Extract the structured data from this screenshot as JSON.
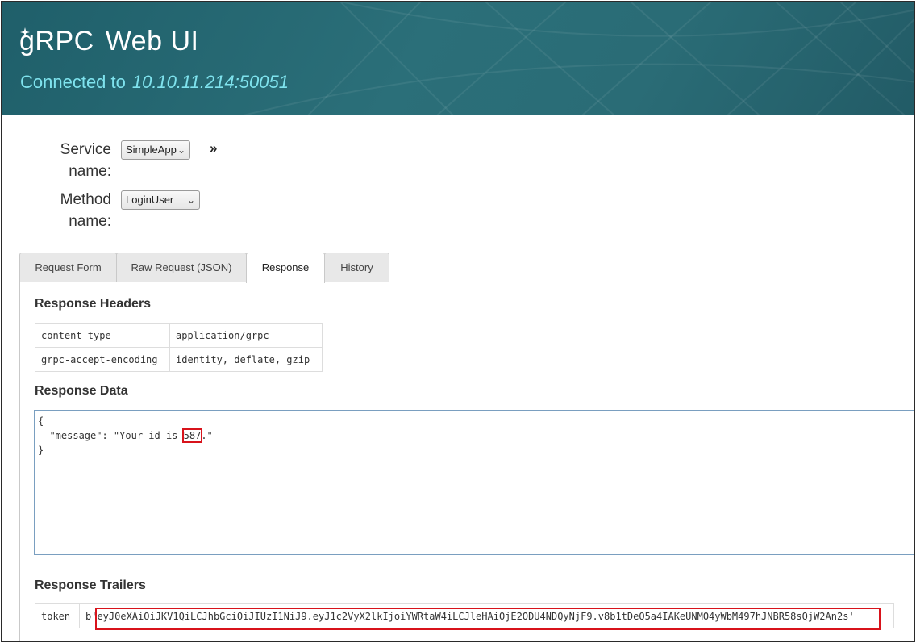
{
  "header": {
    "logo_text": "gRPC",
    "app_title": "Web UI",
    "connected_label": "Connected to",
    "address": "10.10.11.214:50051"
  },
  "selectors": {
    "service_label": "Service name:",
    "service_value": "SimpleApp",
    "method_label": "Method name:",
    "method_value": "LoginUser",
    "expand_glyph": "»"
  },
  "tabs": [
    {
      "label": "Request Form",
      "active": false
    },
    {
      "label": "Raw Request (JSON)",
      "active": false
    },
    {
      "label": "Response",
      "active": true
    },
    {
      "label": "History",
      "active": false
    }
  ],
  "response_headers": {
    "title": "Response Headers",
    "rows": [
      {
        "key": "content-type",
        "value": "application/grpc"
      },
      {
        "key": "grpc-accept-encoding",
        "value": "identity, deflate, gzip"
      }
    ]
  },
  "response_data": {
    "title": "Response Data",
    "line1": "{",
    "line2_prefix": "  \"message\": \"Your id is ",
    "line2_id": "587",
    "line2_suffix": ".\"",
    "line3": "}"
  },
  "response_trailers": {
    "title": "Response Trailers",
    "key": "token",
    "value_prefix": "b'",
    "value_token": "eyJ0eXAiOiJKV1QiLCJhbGciOiJIUzI1NiJ9.eyJ1c2VyX2lkIjoiYWRtaW4iLCJleHAiOjE2ODU4NDQyNjF9.v8b1tDeQ5a4IAKeUNMO4yWbM497hJNBR58sQjW2An2s",
    "value_suffix": "'"
  },
  "colors": {
    "header_bg": "#2a6c76",
    "connected_text": "#7fe3ee",
    "highlight": "#d8131b"
  }
}
